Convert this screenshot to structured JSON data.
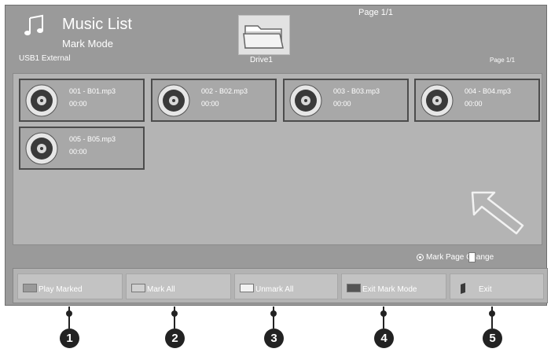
{
  "header": {
    "title": "Music List",
    "mode": "Mark Mode",
    "device": "USB1 External",
    "drive": "Drive1",
    "page_top": "Page 1/1",
    "page_right": "Page 1/1"
  },
  "tracks": [
    {
      "name": "001 - B01.mp3",
      "duration": "00:00"
    },
    {
      "name": "002 - B02.mp3",
      "duration": "00:00"
    },
    {
      "name": "003 - B03.mp3",
      "duration": "00:00"
    },
    {
      "name": "004 - B04.mp3",
      "duration": "00:00"
    },
    {
      "name": "005 - B05.mp3",
      "duration": "00:00"
    }
  ],
  "mark_page": "Mark Page Change",
  "buttons": {
    "play_marked": {
      "label": "Play Marked",
      "color": "#9a9a9a"
    },
    "mark_all": {
      "label": "Mark All",
      "color": "#d0d0d0"
    },
    "unmark_all": {
      "label": "Unmark All",
      "color": "#f2f2f2"
    },
    "exit_mark_mode": {
      "label": "Exit Mark Mode",
      "color": "#555555"
    },
    "exit": {
      "label": "Exit",
      "icon": "exit-icon"
    }
  },
  "callouts": [
    "1",
    "2",
    "3",
    "4",
    "5"
  ],
  "icons": {
    "music": "music-note-icon",
    "folder": "folder-icon",
    "disc": "disc-icon",
    "pointer": "pointer-arrow-icon"
  }
}
